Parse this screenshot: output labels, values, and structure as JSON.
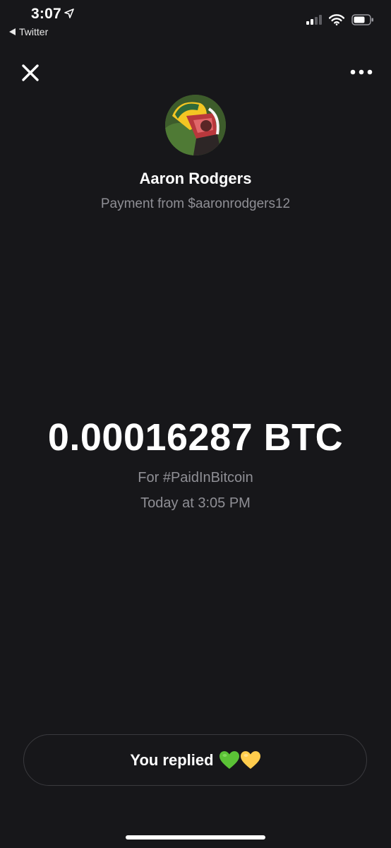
{
  "status_bar": {
    "time": "3:07",
    "back_app": "Twitter"
  },
  "payment": {
    "sender_name": "Aaron Rodgers",
    "sender_subtitle": "Payment from $aaronrodgers12",
    "amount": "0.00016287 BTC",
    "note": "For #PaidInBitcoin",
    "date": "Today at 3:05 PM"
  },
  "reply": {
    "label": "You replied"
  },
  "icons": {
    "close": "close-icon",
    "more": "more-icon",
    "location": "location-arrow-icon",
    "back": "back-arrow-icon",
    "signal": "cellular-signal-icon",
    "wifi": "wifi-icon",
    "battery": "battery-icon",
    "green_heart": "green-heart-icon",
    "yellow_heart": "yellow-heart-icon"
  },
  "colors": {
    "background": "#17171a",
    "text_primary": "#ffffff",
    "text_secondary": "#8f8f95",
    "pill_border": "#3a3a3e",
    "green_heart": "#5bc236",
    "yellow_heart": "#ffcc4d"
  }
}
